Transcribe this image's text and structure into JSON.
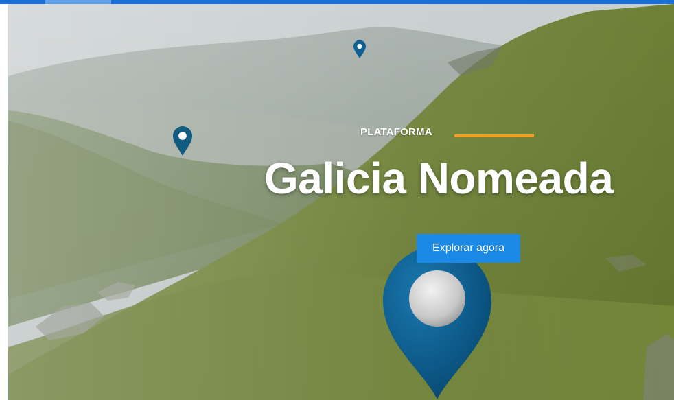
{
  "hero": {
    "kicker": "PLATAFORMA",
    "title": "Galicia Nomeada",
    "cta_label": "Explorar agora"
  },
  "colors": {
    "top_bar": "#1a6fd6",
    "accent_line": "#f0a020",
    "cta": "#1a8ae6",
    "pin": "#0d5a8a"
  },
  "icons": {
    "small_pins": [
      "map-pin-icon",
      "map-pin-icon"
    ],
    "big_pin": "map-pin-icon"
  }
}
